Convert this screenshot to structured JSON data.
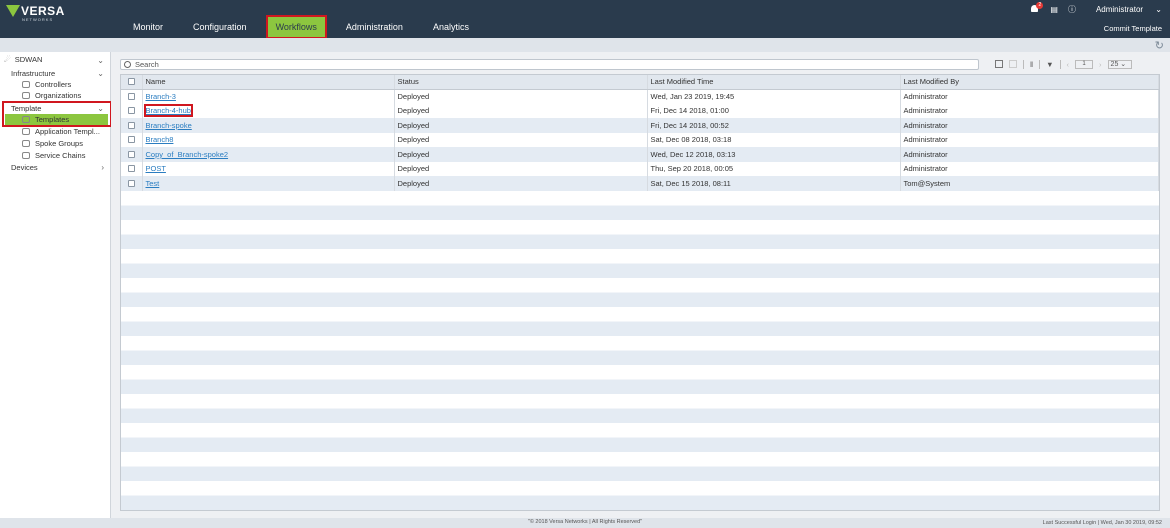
{
  "header": {
    "logo_text": "VERSA",
    "logo_sub": "NETWORKS",
    "nav": [
      "Monitor",
      "Configuration",
      "Workflows",
      "Administration",
      "Analytics"
    ],
    "active_nav": "Workflows",
    "notification_count": "2",
    "user": "Administrator",
    "commit_label": "Commit Template"
  },
  "sidebar": {
    "root": "SDWAN",
    "infrastructure": "Infrastructure",
    "controllers": "Controllers",
    "organizations": "Organizations",
    "template": "Template",
    "templates": "Templates",
    "app_templates": "Application Templ...",
    "spoke_groups": "Spoke Groups",
    "service_chains": "Service Chains",
    "devices": "Devices"
  },
  "search": {
    "placeholder": "Search"
  },
  "toolbar": {
    "page": "1",
    "page_size": "25"
  },
  "table": {
    "columns": [
      "Name",
      "Status",
      "Last Modified Time",
      "Last Modified By"
    ],
    "rows": [
      [
        "Branch-3",
        "Deployed",
        "Wed, Jan 23 2019, 19:45",
        "Administrator"
      ],
      [
        "Branch-4-hub",
        "Deployed",
        "Fri, Dec 14 2018, 01:00",
        "Administrator"
      ],
      [
        "Branch-spoke",
        "Deployed",
        "Fri, Dec 14 2018, 00:52",
        "Administrator"
      ],
      [
        "Branch8",
        "Deployed",
        "Sat, Dec 08 2018, 03:18",
        "Administrator"
      ],
      [
        "Copy_of_Branch-spoke2",
        "Deployed",
        "Wed, Dec 12 2018, 03:13",
        "Administrator"
      ],
      [
        "POST",
        "Deployed",
        "Thu, Sep 20 2018, 00:05",
        "Administrator"
      ],
      [
        "Test",
        "Deployed",
        "Sat, Dec 15 2018, 08:11",
        "Tom@System"
      ]
    ]
  },
  "footer": {
    "copyright": "\"© 2018 Versa Networks | All Rights Reserved\"",
    "last_login": "Last Successful Login | Wed, Jan 30 2019, 09:52"
  }
}
